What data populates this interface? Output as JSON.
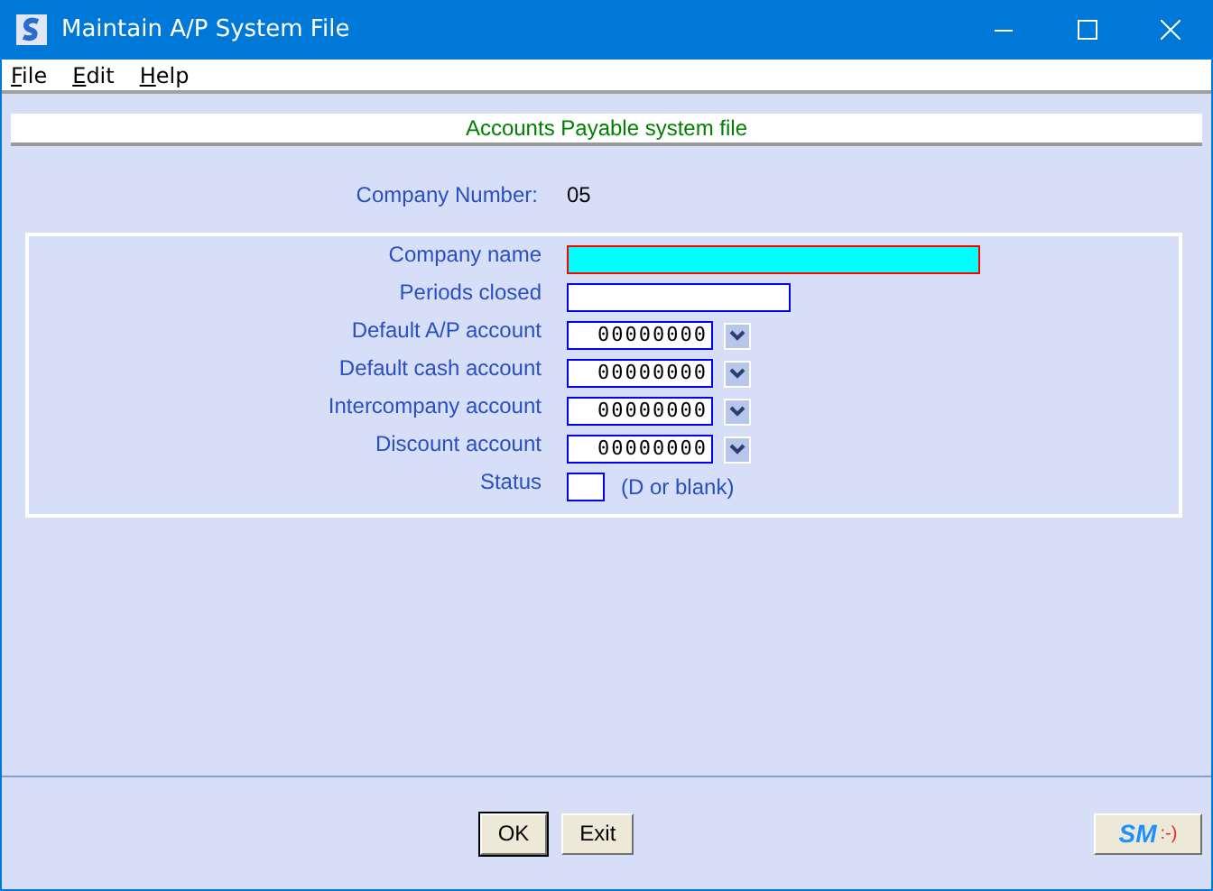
{
  "window": {
    "title": "Maintain A/P System File"
  },
  "menu": [
    {
      "label": "File"
    },
    {
      "label": "Edit"
    },
    {
      "label": "Help"
    }
  ],
  "header": "Accounts Payable system file",
  "company_number": {
    "label": "Company Number:",
    "value": "05"
  },
  "fields": [
    {
      "kind": "text",
      "label": "Company name",
      "focused": true
    },
    {
      "kind": "text",
      "label": "Periods closed",
      "focused": false
    },
    {
      "kind": "account",
      "label": "Default A/P account",
      "value": "00000000",
      "focused": false
    },
    {
      "kind": "account",
      "label": "Default cash account",
      "value": "00000000",
      "focused": false
    },
    {
      "kind": "account",
      "label": "Intercompany account",
      "value": "00000000",
      "focused": false
    },
    {
      "kind": "account",
      "label": "Discount account",
      "value": "00000000",
      "focused": false
    },
    {
      "kind": "status",
      "label": "Status",
      "hint": "(D or blank)",
      "focused": false
    }
  ],
  "buttons": [
    {
      "label": "OK",
      "default": true
    },
    {
      "label": "Exit",
      "default": false
    }
  ],
  "logo": {
    "text": "SM",
    "smiley": ":-)"
  }
}
